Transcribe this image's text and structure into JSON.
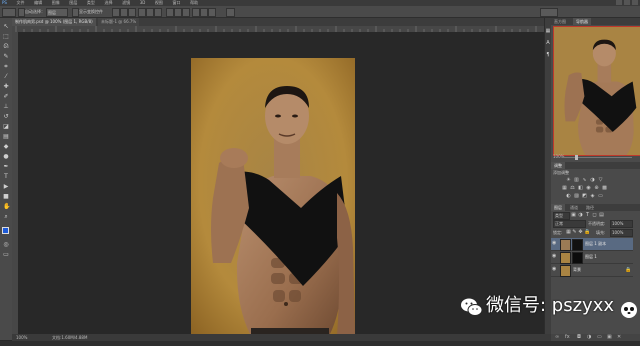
{
  "menu": {
    "items": [
      "PS",
      "文件",
      "编辑",
      "图像",
      "图层",
      "类型",
      "选择",
      "滤镜",
      "3D",
      "视图",
      "窗口",
      "帮助"
    ]
  },
  "options_bar": {
    "auto_select_label": "自动选择：",
    "auto_select_value": "图层",
    "transform_label": "显示变换控件"
  },
  "document": {
    "tab_title": "制作肌肉男.psd @ 100% (图层 1, RGB/8)",
    "tab_second": "未标题-1 @ 66.7%",
    "zoom": "100%",
    "doc_size": "文档:1.60M/4.88M"
  },
  "navigator": {
    "tabs": [
      "直方图",
      "导航器"
    ]
  },
  "adjustments": {
    "title": "调整",
    "subtitle": "添加调整"
  },
  "layers": {
    "tabs": [
      "图层",
      "通道",
      "路径"
    ],
    "kind_label": "类型",
    "blend_mode": "正常",
    "opacity_label": "不透明度:",
    "opacity_value": "100%",
    "lock_label": "锁定:",
    "fill_label": "填充:",
    "fill_value": "100%",
    "items": [
      {
        "name": "图层 1 副本",
        "selected": true
      },
      {
        "name": "图层 1",
        "selected": false
      },
      {
        "name": "背景",
        "selected": false
      }
    ]
  },
  "watermark": {
    "text": "微信号: pszyxx"
  },
  "colors": {
    "foreground": "#1e5bd8",
    "background": "#ffffff",
    "selected_layer": "#596a82",
    "photo_bg": "#b3873d"
  }
}
